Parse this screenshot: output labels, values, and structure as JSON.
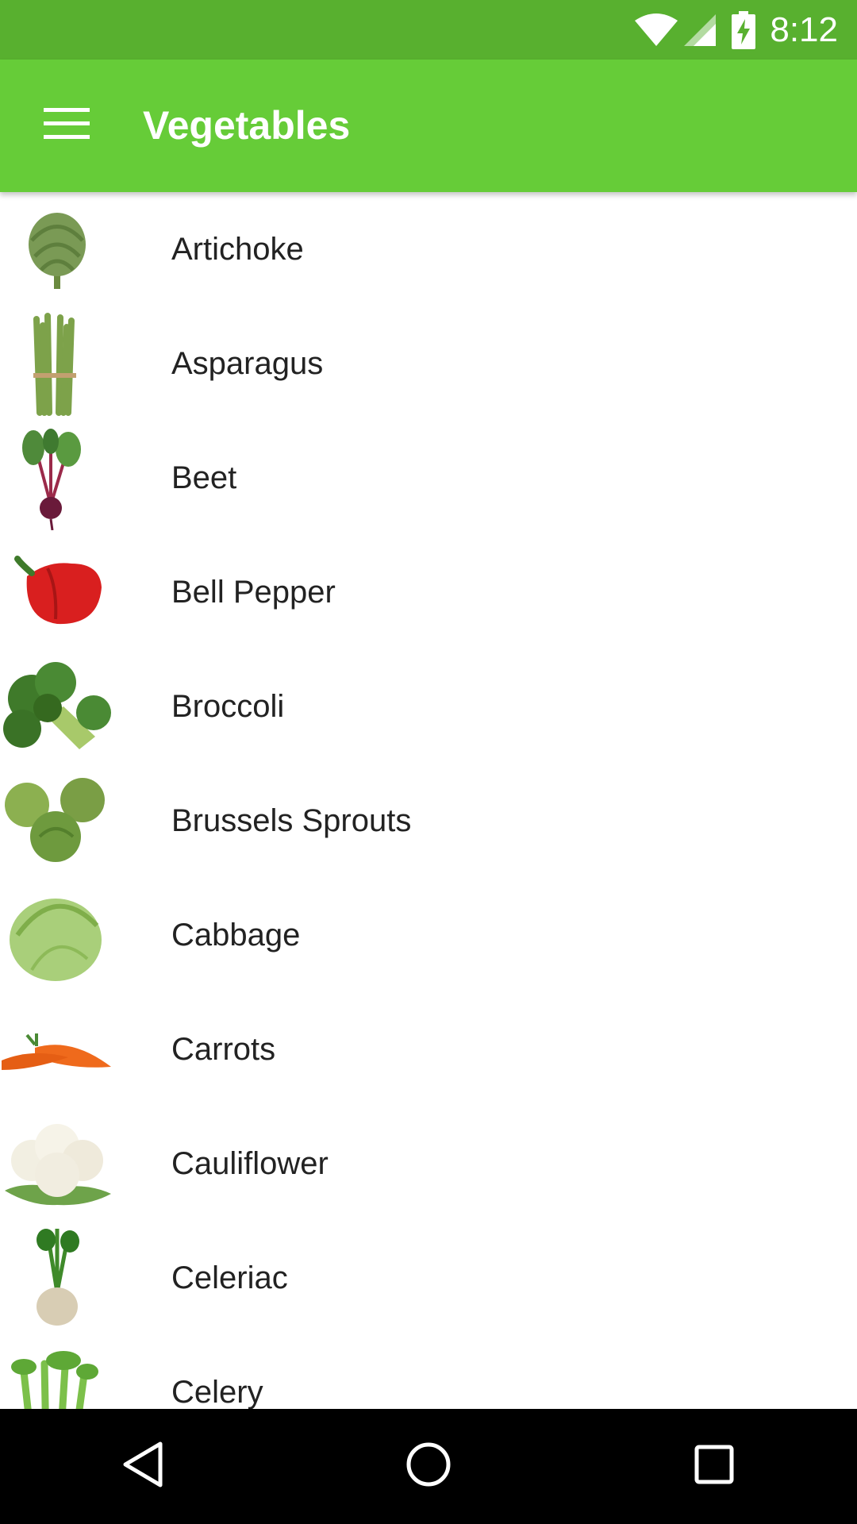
{
  "status_bar": {
    "time": "8:12",
    "icons": [
      "wifi-icon",
      "cell-signal-icon",
      "battery-charging-icon"
    ]
  },
  "app_bar": {
    "title": "Vegetables",
    "menu_icon": "hamburger-menu-icon",
    "color": "#66CC38",
    "status_color": "#58B02F"
  },
  "vegetables": [
    {
      "label": "Artichoke",
      "icon": "artichoke-icon"
    },
    {
      "label": "Asparagus",
      "icon": "asparagus-icon"
    },
    {
      "label": "Beet",
      "icon": "beet-icon"
    },
    {
      "label": "Bell Pepper",
      "icon": "bell-pepper-icon"
    },
    {
      "label": "Broccoli",
      "icon": "broccoli-icon"
    },
    {
      "label": "Brussels Sprouts",
      "icon": "brussels-sprouts-icon"
    },
    {
      "label": "Cabbage",
      "icon": "cabbage-icon"
    },
    {
      "label": "Carrots",
      "icon": "carrots-icon"
    },
    {
      "label": "Cauliflower",
      "icon": "cauliflower-icon"
    },
    {
      "label": "Celeriac",
      "icon": "celeriac-icon"
    },
    {
      "label": "Celery",
      "icon": "celery-icon"
    }
  ],
  "nav_bar": {
    "buttons": [
      "back-icon",
      "home-icon",
      "recents-icon"
    ]
  }
}
